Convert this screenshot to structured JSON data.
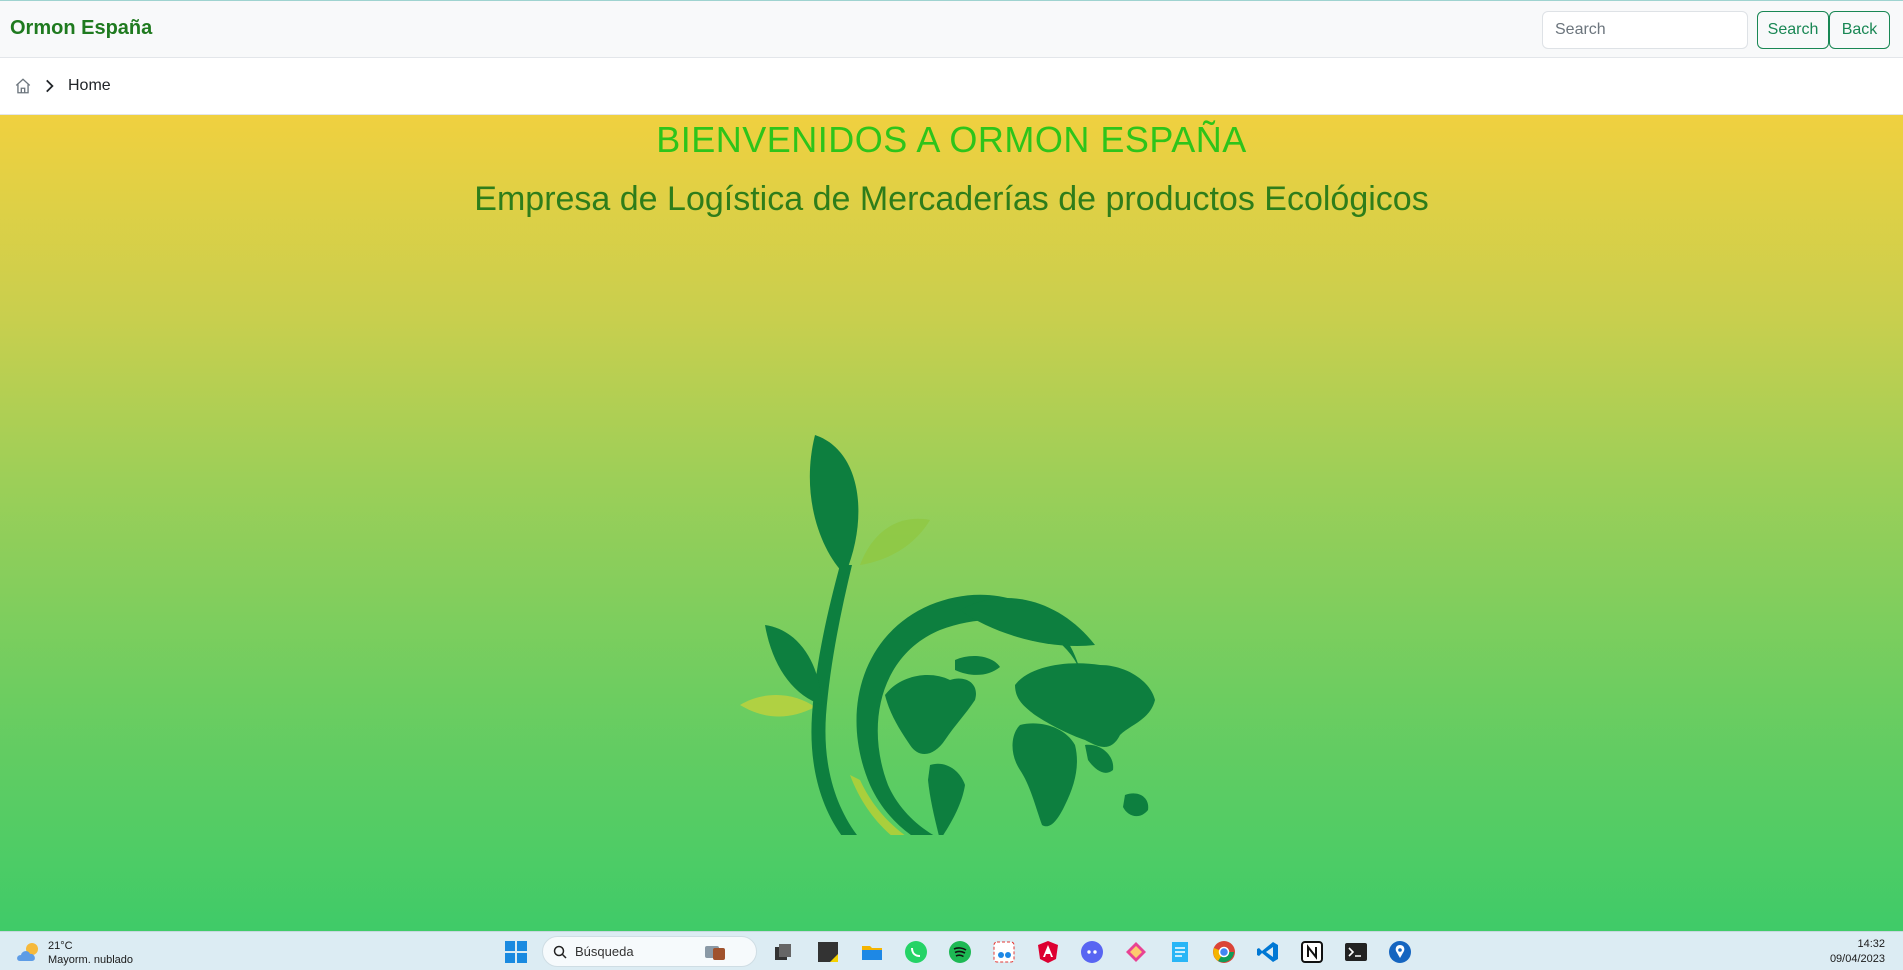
{
  "navbar": {
    "brand": "Ormon España",
    "search_placeholder": "Search",
    "search_button": "Search",
    "back_button": "Back"
  },
  "breadcrumb": {
    "items": [
      "Home"
    ]
  },
  "hero": {
    "title": "BIENVENIDOS A ORMON ESPAÑA",
    "subtitle": "Empresa de Logística de Mercaderías de productos Ecológicos"
  },
  "taskbar": {
    "weather_temp": "21°C",
    "weather_desc": "Mayorm. nublado",
    "search_placeholder": "Búsqueda",
    "time": "14:32",
    "date": "09/04/2023",
    "icons": [
      "windows-start-icon",
      "search-icon",
      "widgets-icon",
      "task-view-icon",
      "sticky-notes-icon",
      "file-explorer-icon",
      "whatsapp-icon",
      "spotify-icon",
      "snipping-tool-icon",
      "angular-icon",
      "discord-icon",
      "sourcetree-icon",
      "notepad-icon",
      "chrome-icon",
      "vscode-icon",
      "notion-icon",
      "terminal-icon",
      "maps-icon"
    ]
  },
  "colors": {
    "brand": "#1f7a1f",
    "accent": "#198754",
    "hero_title": "#2ec41a",
    "hero_subtitle": "#2e7d1a",
    "logo_green": "#0d7f3f"
  }
}
